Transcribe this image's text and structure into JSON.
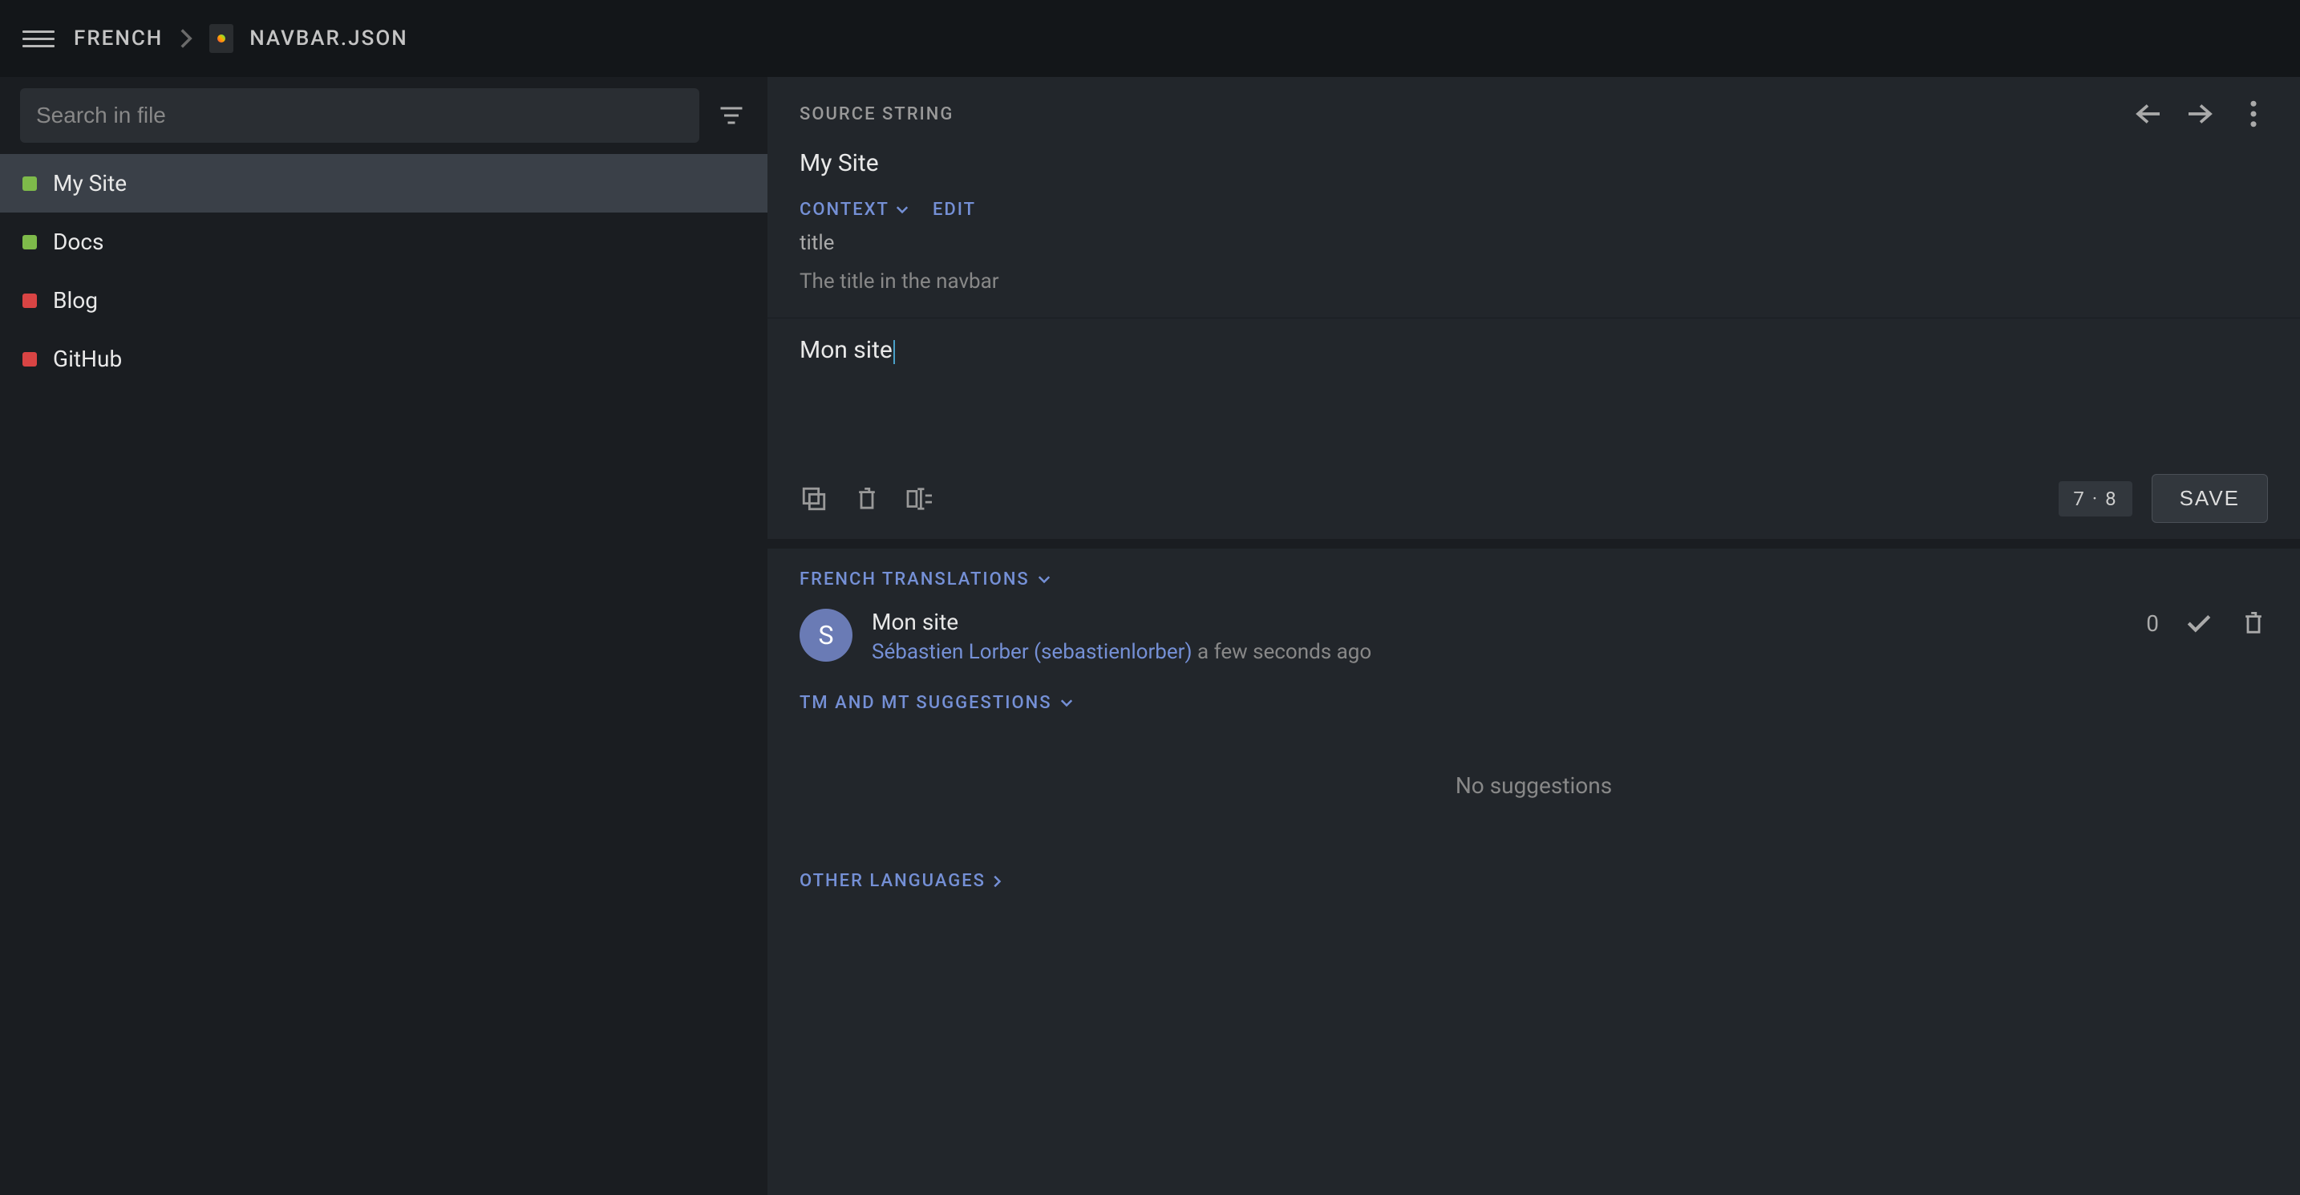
{
  "header": {
    "breadcrumb_language": "FRENCH",
    "breadcrumb_file": "NAVBAR.JSON"
  },
  "sidebar": {
    "search_placeholder": "Search in file",
    "items": [
      {
        "label": "My Site",
        "status": "green",
        "active": true
      },
      {
        "label": "Docs",
        "status": "green",
        "active": false
      },
      {
        "label": "Blog",
        "status": "red",
        "active": false
      },
      {
        "label": "GitHub",
        "status": "red",
        "active": false
      }
    ]
  },
  "editor": {
    "source_label": "SOURCE STRING",
    "source_string": "My Site",
    "context_label": "CONTEXT",
    "edit_label": "EDIT",
    "context_key": "title",
    "context_description": "The title in the navbar",
    "translation_value": "Mon site",
    "char_count": "7 · 8",
    "save_label": "SAVE"
  },
  "translations": {
    "header": "FRENCH TRANSLATIONS",
    "entry": {
      "avatar_initial": "S",
      "text": "Mon site",
      "author": "Sébastien Lorber (sebastienlorber)",
      "time": "a few seconds ago",
      "votes": "0"
    }
  },
  "suggestions": {
    "header": "TM AND MT SUGGESTIONS",
    "empty": "No suggestions"
  },
  "other_languages": {
    "header": "OTHER LANGUAGES"
  }
}
